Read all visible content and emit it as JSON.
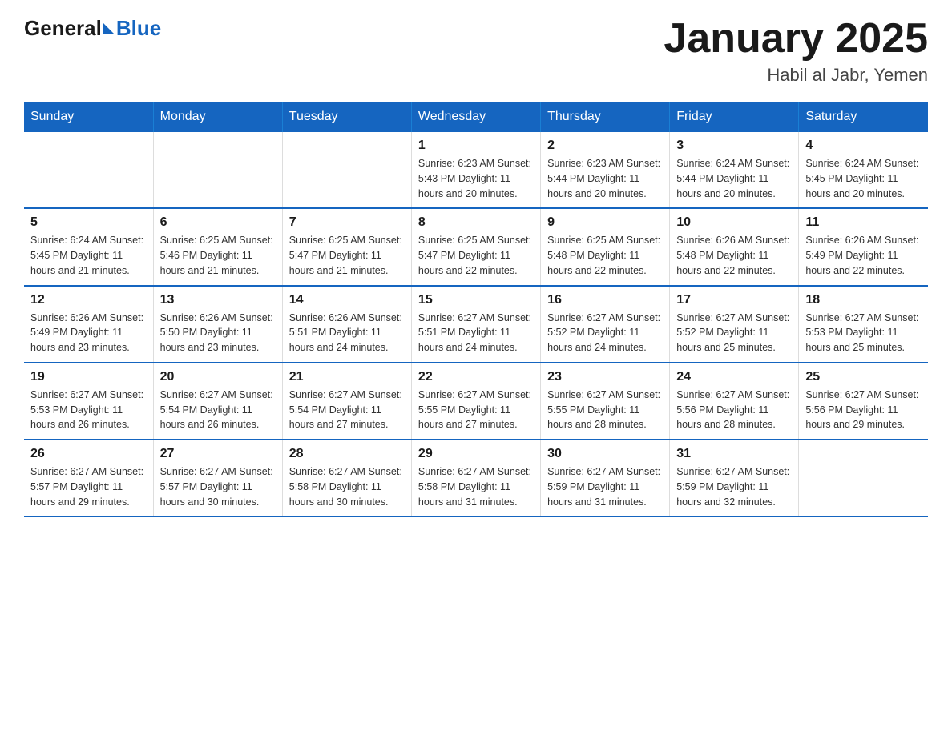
{
  "header": {
    "logo_general": "General",
    "logo_blue": "Blue",
    "month_year": "January 2025",
    "location": "Habil al Jabr, Yemen"
  },
  "days_of_week": [
    "Sunday",
    "Monday",
    "Tuesday",
    "Wednesday",
    "Thursday",
    "Friday",
    "Saturday"
  ],
  "weeks": [
    [
      {
        "day": "",
        "info": ""
      },
      {
        "day": "",
        "info": ""
      },
      {
        "day": "",
        "info": ""
      },
      {
        "day": "1",
        "info": "Sunrise: 6:23 AM\nSunset: 5:43 PM\nDaylight: 11 hours and 20 minutes."
      },
      {
        "day": "2",
        "info": "Sunrise: 6:23 AM\nSunset: 5:44 PM\nDaylight: 11 hours and 20 minutes."
      },
      {
        "day": "3",
        "info": "Sunrise: 6:24 AM\nSunset: 5:44 PM\nDaylight: 11 hours and 20 minutes."
      },
      {
        "day": "4",
        "info": "Sunrise: 6:24 AM\nSunset: 5:45 PM\nDaylight: 11 hours and 20 minutes."
      }
    ],
    [
      {
        "day": "5",
        "info": "Sunrise: 6:24 AM\nSunset: 5:45 PM\nDaylight: 11 hours and 21 minutes."
      },
      {
        "day": "6",
        "info": "Sunrise: 6:25 AM\nSunset: 5:46 PM\nDaylight: 11 hours and 21 minutes."
      },
      {
        "day": "7",
        "info": "Sunrise: 6:25 AM\nSunset: 5:47 PM\nDaylight: 11 hours and 21 minutes."
      },
      {
        "day": "8",
        "info": "Sunrise: 6:25 AM\nSunset: 5:47 PM\nDaylight: 11 hours and 22 minutes."
      },
      {
        "day": "9",
        "info": "Sunrise: 6:25 AM\nSunset: 5:48 PM\nDaylight: 11 hours and 22 minutes."
      },
      {
        "day": "10",
        "info": "Sunrise: 6:26 AM\nSunset: 5:48 PM\nDaylight: 11 hours and 22 minutes."
      },
      {
        "day": "11",
        "info": "Sunrise: 6:26 AM\nSunset: 5:49 PM\nDaylight: 11 hours and 22 minutes."
      }
    ],
    [
      {
        "day": "12",
        "info": "Sunrise: 6:26 AM\nSunset: 5:49 PM\nDaylight: 11 hours and 23 minutes."
      },
      {
        "day": "13",
        "info": "Sunrise: 6:26 AM\nSunset: 5:50 PM\nDaylight: 11 hours and 23 minutes."
      },
      {
        "day": "14",
        "info": "Sunrise: 6:26 AM\nSunset: 5:51 PM\nDaylight: 11 hours and 24 minutes."
      },
      {
        "day": "15",
        "info": "Sunrise: 6:27 AM\nSunset: 5:51 PM\nDaylight: 11 hours and 24 minutes."
      },
      {
        "day": "16",
        "info": "Sunrise: 6:27 AM\nSunset: 5:52 PM\nDaylight: 11 hours and 24 minutes."
      },
      {
        "day": "17",
        "info": "Sunrise: 6:27 AM\nSunset: 5:52 PM\nDaylight: 11 hours and 25 minutes."
      },
      {
        "day": "18",
        "info": "Sunrise: 6:27 AM\nSunset: 5:53 PM\nDaylight: 11 hours and 25 minutes."
      }
    ],
    [
      {
        "day": "19",
        "info": "Sunrise: 6:27 AM\nSunset: 5:53 PM\nDaylight: 11 hours and 26 minutes."
      },
      {
        "day": "20",
        "info": "Sunrise: 6:27 AM\nSunset: 5:54 PM\nDaylight: 11 hours and 26 minutes."
      },
      {
        "day": "21",
        "info": "Sunrise: 6:27 AM\nSunset: 5:54 PM\nDaylight: 11 hours and 27 minutes."
      },
      {
        "day": "22",
        "info": "Sunrise: 6:27 AM\nSunset: 5:55 PM\nDaylight: 11 hours and 27 minutes."
      },
      {
        "day": "23",
        "info": "Sunrise: 6:27 AM\nSunset: 5:55 PM\nDaylight: 11 hours and 28 minutes."
      },
      {
        "day": "24",
        "info": "Sunrise: 6:27 AM\nSunset: 5:56 PM\nDaylight: 11 hours and 28 minutes."
      },
      {
        "day": "25",
        "info": "Sunrise: 6:27 AM\nSunset: 5:56 PM\nDaylight: 11 hours and 29 minutes."
      }
    ],
    [
      {
        "day": "26",
        "info": "Sunrise: 6:27 AM\nSunset: 5:57 PM\nDaylight: 11 hours and 29 minutes."
      },
      {
        "day": "27",
        "info": "Sunrise: 6:27 AM\nSunset: 5:57 PM\nDaylight: 11 hours and 30 minutes."
      },
      {
        "day": "28",
        "info": "Sunrise: 6:27 AM\nSunset: 5:58 PM\nDaylight: 11 hours and 30 minutes."
      },
      {
        "day": "29",
        "info": "Sunrise: 6:27 AM\nSunset: 5:58 PM\nDaylight: 11 hours and 31 minutes."
      },
      {
        "day": "30",
        "info": "Sunrise: 6:27 AM\nSunset: 5:59 PM\nDaylight: 11 hours and 31 minutes."
      },
      {
        "day": "31",
        "info": "Sunrise: 6:27 AM\nSunset: 5:59 PM\nDaylight: 11 hours and 32 minutes."
      },
      {
        "day": "",
        "info": ""
      }
    ]
  ]
}
